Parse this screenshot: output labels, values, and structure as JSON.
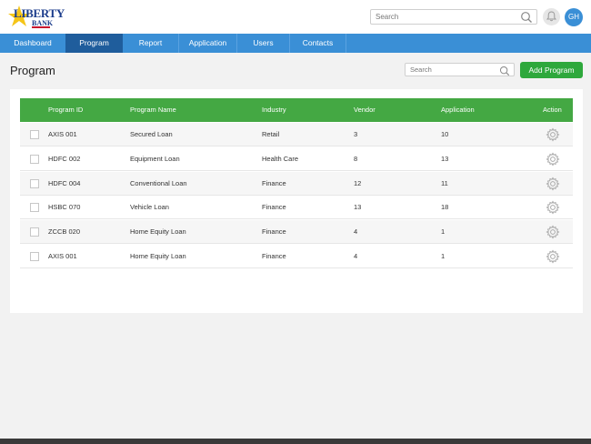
{
  "header": {
    "logo_line1": "LIBERTY",
    "logo_line2": "BANK",
    "search_placeholder": "Search",
    "avatar_initials": "GH"
  },
  "nav": {
    "items": [
      {
        "label": "Dashboard"
      },
      {
        "label": "Program"
      },
      {
        "label": "Report"
      },
      {
        "label": "Application"
      },
      {
        "label": "Users"
      },
      {
        "label": "Contacts"
      }
    ],
    "active": "Program"
  },
  "page": {
    "title": "Program",
    "search_placeholder": "Search",
    "add_button": "Add Program"
  },
  "table": {
    "columns": [
      "Program ID",
      "Program Name",
      "Industry",
      "Vendor",
      "Application",
      "Action"
    ],
    "rows": [
      {
        "id": "AXIS 001",
        "name": "Secured Loan",
        "industry": "Retail",
        "vendor": "3",
        "application": "10"
      },
      {
        "id": "HDFC 002",
        "name": "Equipment Loan",
        "industry": "Health Care",
        "vendor": "8",
        "application": "13"
      },
      {
        "id": "HDFC 004",
        "name": "Conventional Loan",
        "industry": "Finance",
        "vendor": "12",
        "application": "11"
      },
      {
        "id": "HSBC 070",
        "name": "Vehicle Loan",
        "industry": "Finance",
        "vendor": "13",
        "application": "18"
      },
      {
        "id": "ZCCB 020",
        "name": "Home Equity Loan",
        "industry": "Finance",
        "vendor": "4",
        "application": "1"
      },
      {
        "id": "AXIS 001",
        "name": "Home Equity Loan",
        "industry": "Finance",
        "vendor": "4",
        "application": "1"
      }
    ]
  },
  "colors": {
    "nav_bg": "#3a8fd6",
    "nav_active": "#1f5d9c",
    "table_header": "#44a843",
    "add_button": "#2ea83c"
  }
}
